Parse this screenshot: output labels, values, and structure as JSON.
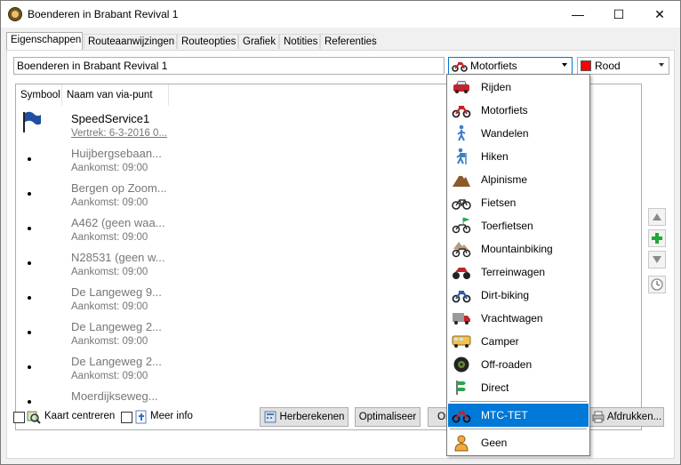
{
  "window": {
    "title": "Boenderen in Brabant Revival 1",
    "minimize": "—",
    "maximize": "☐",
    "close": "✕"
  },
  "tabs": [
    {
      "label": "Eigenschappen"
    },
    {
      "label": "Routeaanwijzingen"
    },
    {
      "label": "Routeopties"
    },
    {
      "label": "Grafiek"
    },
    {
      "label": "Notities"
    },
    {
      "label": "Referenties"
    }
  ],
  "route_name": "Boenderen in Brabant Revival 1",
  "vehicle": {
    "selected": "Motorfiets",
    "icon": "motorcycle-icon"
  },
  "color": {
    "selected": "Rood",
    "swatch": "#ff0000"
  },
  "list": {
    "headers": [
      "Symbool",
      "Naam van via-punt"
    ],
    "rows": [
      {
        "name": "SpeedService1",
        "sub": "Vertrek: 6-3-2016 0..."
      },
      {
        "name": "Huijbergsebaan...",
        "sub": "Aankomst: 09:00"
      },
      {
        "name": "Bergen op Zoom...",
        "sub": "Aankomst: 09:00"
      },
      {
        "name": "A462 (geen waa...",
        "sub": "Aankomst: 09:00"
      },
      {
        "name": "N28531 (geen w...",
        "sub": "Aankomst: 09:00"
      },
      {
        "name": "De Langeweg 9...",
        "sub": "Aankomst: 09:00"
      },
      {
        "name": "De Langeweg 2...",
        "sub": "Aankomst: 09:00"
      },
      {
        "name": "De Langeweg 2...",
        "sub": "Aankomst: 09:00"
      },
      {
        "name": "Moerdijkseweg...",
        "sub": ""
      }
    ]
  },
  "dropdown": {
    "items": [
      {
        "label": "Rijden",
        "icon": "car-icon"
      },
      {
        "label": "Motorfiets",
        "icon": "motorcycle-icon"
      },
      {
        "label": "Wandelen",
        "icon": "walking-icon"
      },
      {
        "label": "Hiken",
        "icon": "hiking-icon"
      },
      {
        "label": "Alpinisme",
        "icon": "mountain-icon"
      },
      {
        "label": "Fietsen",
        "icon": "bicycle-icon"
      },
      {
        "label": "Toerfietsen",
        "icon": "touring-bicycle-icon"
      },
      {
        "label": "Mountainbiking",
        "icon": "mountain-bike-icon"
      },
      {
        "label": "Terreinwagen",
        "icon": "atv-icon"
      },
      {
        "label": "Dirt-biking",
        "icon": "dirt-bike-icon"
      },
      {
        "label": "Vrachtwagen",
        "icon": "truck-icon"
      },
      {
        "label": "Camper",
        "icon": "camper-icon"
      },
      {
        "label": "Off-roaden",
        "icon": "offroad-tire-icon"
      },
      {
        "label": "Direct",
        "icon": "direct-route-icon"
      },
      {
        "label": "MTC-TET",
        "icon": "motorcycle-icon",
        "selected": true
      },
      {
        "label": "Geen",
        "icon": "person-icon"
      }
    ]
  },
  "bottom": {
    "kaart_centreren": "Kaart centreren",
    "meer_info": "Meer info",
    "herberekenen": "Herberekenen",
    "optimaliseer": "Optimaliseer",
    "partial": "Or",
    "afdrukken": "Afdrukken..."
  }
}
